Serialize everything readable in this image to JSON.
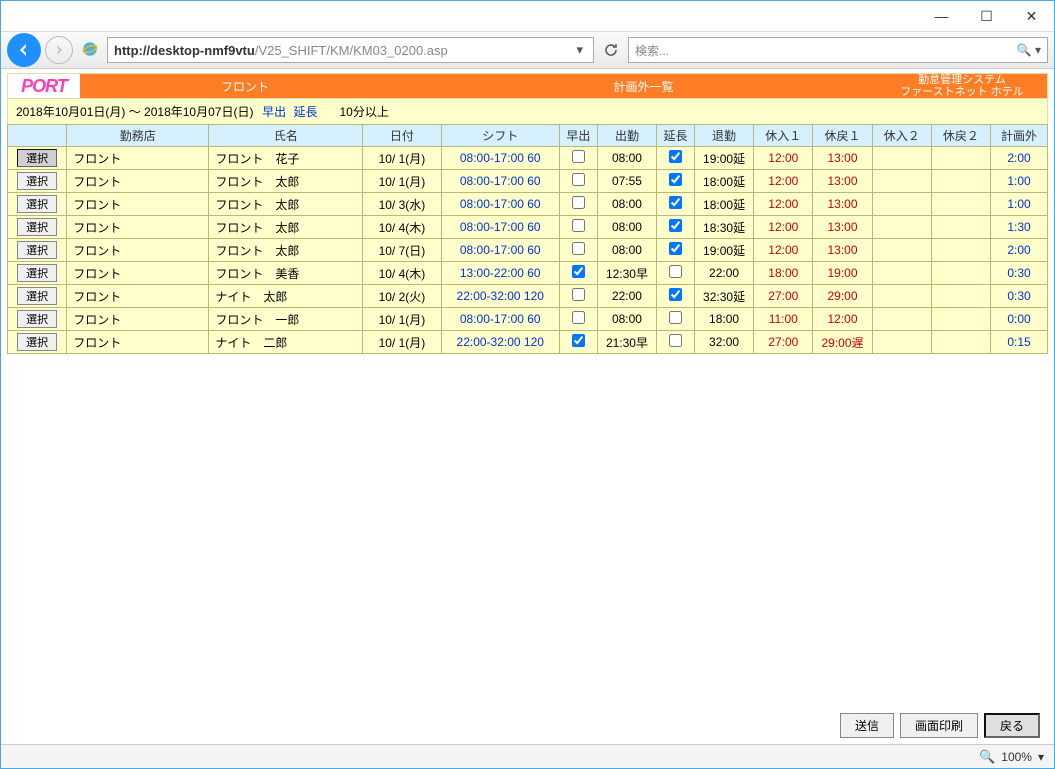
{
  "window": {
    "min": "—",
    "max": "☐",
    "close": "✕"
  },
  "toolbar": {
    "url_host": "http://desktop-nmf9vtu",
    "url_path": "/V25_SHIFT/KM/KM03_0200.asp",
    "search_placeholder": "検索..."
  },
  "header": {
    "logo": "PORT",
    "section1": "フロント",
    "section2": "計画外一覧",
    "section3a": "勤怠管理システム",
    "section3b": "ファーストネット ホテル"
  },
  "dateband": {
    "range": "2018年10月01日(月) ～ 2018年10月07日(日)",
    "link1": "早出",
    "link2": "延長",
    "filter": "10分以上"
  },
  "columns": [
    "",
    "勤務店",
    "氏名",
    "日付",
    "シフト",
    "早出",
    "出勤",
    "延長",
    "退勤",
    "休入１",
    "休戻１",
    "休入２",
    "休戻２",
    "計画外"
  ],
  "select_label": "選択",
  "rows": [
    {
      "sel": true,
      "shop": "フロント",
      "name": "フロント　花子",
      "date": "10/ 1(月)",
      "shift": "08:00-17:00 60",
      "hayac": false,
      "syukkin": "08:00",
      "enc": true,
      "taikin": "19:00延",
      "ki1": "12:00",
      "km1": "13:00",
      "ki2": "",
      "km2": "",
      "plan": "2:00"
    },
    {
      "sel": false,
      "shop": "フロント",
      "name": "フロント　太郎",
      "date": "10/ 1(月)",
      "shift": "08:00-17:00 60",
      "hayac": false,
      "syukkin": "07:55",
      "enc": true,
      "taikin": "18:00延",
      "ki1": "12:00",
      "km1": "13:00",
      "ki2": "",
      "km2": "",
      "plan": "1:00"
    },
    {
      "sel": false,
      "shop": "フロント",
      "name": "フロント　太郎",
      "date": "10/ 3(水)",
      "shift": "08:00-17:00 60",
      "hayac": false,
      "syukkin": "08:00",
      "enc": true,
      "taikin": "18:00延",
      "ki1": "12:00",
      "km1": "13:00",
      "ki2": "",
      "km2": "",
      "plan": "1:00"
    },
    {
      "sel": false,
      "shop": "フロント",
      "name": "フロント　太郎",
      "date": "10/ 4(木)",
      "shift": "08:00-17:00 60",
      "hayac": false,
      "syukkin": "08:00",
      "enc": true,
      "taikin": "18:30延",
      "ki1": "12:00",
      "km1": "13:00",
      "ki2": "",
      "km2": "",
      "plan": "1:30"
    },
    {
      "sel": false,
      "shop": "フロント",
      "name": "フロント　太郎",
      "date": "10/ 7(日)",
      "shift": "08:00-17:00 60",
      "hayac": false,
      "syukkin": "08:00",
      "enc": true,
      "taikin": "19:00延",
      "ki1": "12:00",
      "km1": "13:00",
      "ki2": "",
      "km2": "",
      "plan": "2:00"
    },
    {
      "sel": false,
      "shop": "フロント",
      "name": "フロント　美香",
      "date": "10/ 4(木)",
      "shift": "13:00-22:00 60",
      "hayac": true,
      "syukkin": "12:30早",
      "enc": false,
      "taikin": "22:00",
      "ki1": "18:00",
      "km1": "19:00",
      "ki2": "",
      "km2": "",
      "plan": "0:30"
    },
    {
      "sel": false,
      "shop": "フロント",
      "name": "ナイト　太郎",
      "date": "10/ 2(火)",
      "shift": "22:00-32:00 120",
      "hayac": false,
      "syukkin": "22:00",
      "enc": true,
      "taikin": "32:30延",
      "ki1": "27:00",
      "km1": "29:00",
      "ki2": "",
      "km2": "",
      "plan": "0:30"
    },
    {
      "sel": false,
      "shop": "フロント",
      "name": "フロント　一郎",
      "date": "10/ 1(月)",
      "shift": "08:00-17:00 60",
      "hayac": false,
      "syukkin": "08:00",
      "enc": false,
      "taikin": "18:00",
      "ki1": "11:00",
      "km1": "12:00",
      "ki2": "",
      "km2": "",
      "plan": "0:00"
    },
    {
      "sel": false,
      "shop": "フロント",
      "name": "ナイト　二郎",
      "date": "10/ 1(月)",
      "shift": "22:00-32:00 120",
      "hayac": true,
      "syukkin": "21:30早",
      "enc": false,
      "taikin": "32:00",
      "ki1": "27:00",
      "km1": "29:00遅",
      "ki2": "",
      "km2": "",
      "plan": "0:15"
    }
  ],
  "footer": {
    "send": "送信",
    "print": "画面印刷",
    "back": "戻る"
  },
  "status": {
    "zoom": "100%"
  }
}
